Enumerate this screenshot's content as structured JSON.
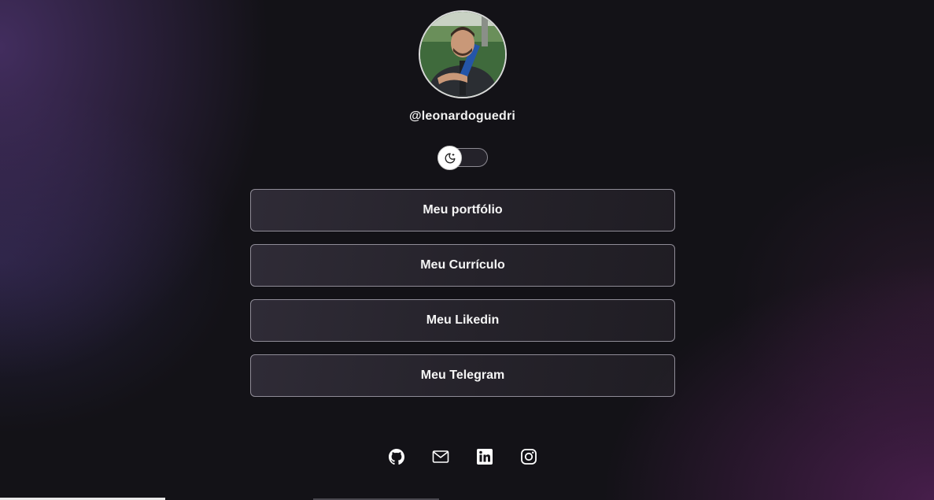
{
  "profile": {
    "username": "@leonardoguedri",
    "avatar_alt": "profile photo"
  },
  "theme_toggle": {
    "icon": "moon-icon",
    "state": "dark"
  },
  "links": [
    {
      "label": "Meu portfólio"
    },
    {
      "label": "Meu Currículo"
    },
    {
      "label": "Meu Likedin"
    },
    {
      "label": "Meu Telegram"
    }
  ],
  "socials": [
    {
      "icon": "github-icon"
    },
    {
      "icon": "email-icon"
    },
    {
      "icon": "linkedin-icon"
    },
    {
      "icon": "instagram-icon"
    }
  ],
  "colors": {
    "background": "#131217",
    "accent_purple": "#4e3470",
    "button_border": "#8f8c97",
    "text": "#f5f5f5"
  }
}
